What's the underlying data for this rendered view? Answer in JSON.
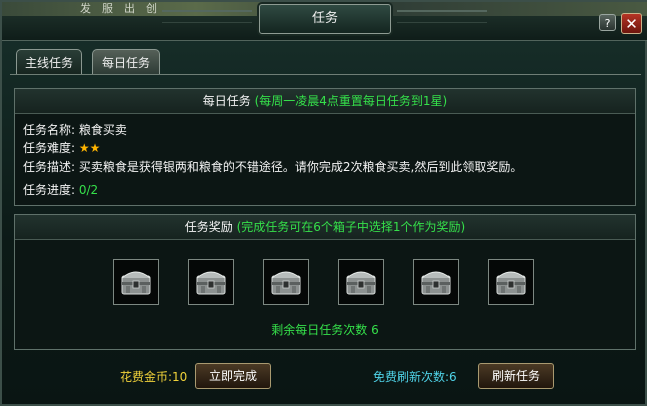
{
  "top_strip": {
    "items": [
      "发",
      "服",
      "出",
      "创"
    ]
  },
  "window": {
    "title": "任务"
  },
  "title_buttons": {
    "help_label": "?",
    "close_label": "✕"
  },
  "tabs": [
    {
      "label": "主线任务",
      "active": false
    },
    {
      "label": "每日任务",
      "active": true
    }
  ],
  "daily": {
    "heading": "每日任务",
    "heading_note": "(每周一凌晨4点重置每日任务到1星)",
    "name_label": "任务名称:",
    "name_value": "粮食买卖",
    "difficulty_label": "任务难度:",
    "difficulty_stars": 2,
    "desc_label": "任务描述:",
    "desc_value": "买卖粮食是获得银两和粮食的不错途径。请你完成2次粮食买卖,然后到此领取奖励。",
    "progress_label": "任务进度:",
    "progress_value": "0/2"
  },
  "reward": {
    "heading": "任务奖励",
    "heading_note": "(完成任务可在6个箱子中选择1个作为奖励)",
    "chests": [
      "chest-1",
      "chest-2",
      "chest-3",
      "chest-4",
      "chest-5",
      "chest-6"
    ],
    "remaining": "剩余每日任务次数 6"
  },
  "footer": {
    "cost_label": "花费金币:",
    "cost_value": "10",
    "complete_button": "立即完成",
    "free_label": "免费刷新次数:",
    "free_value": "6",
    "refresh_button": "刷新任务"
  },
  "colors": {
    "green_text": "#35e04a",
    "star": "#ffb400",
    "cyan_label": "#4fd3e8",
    "yellow_label": "#f0d23a"
  }
}
